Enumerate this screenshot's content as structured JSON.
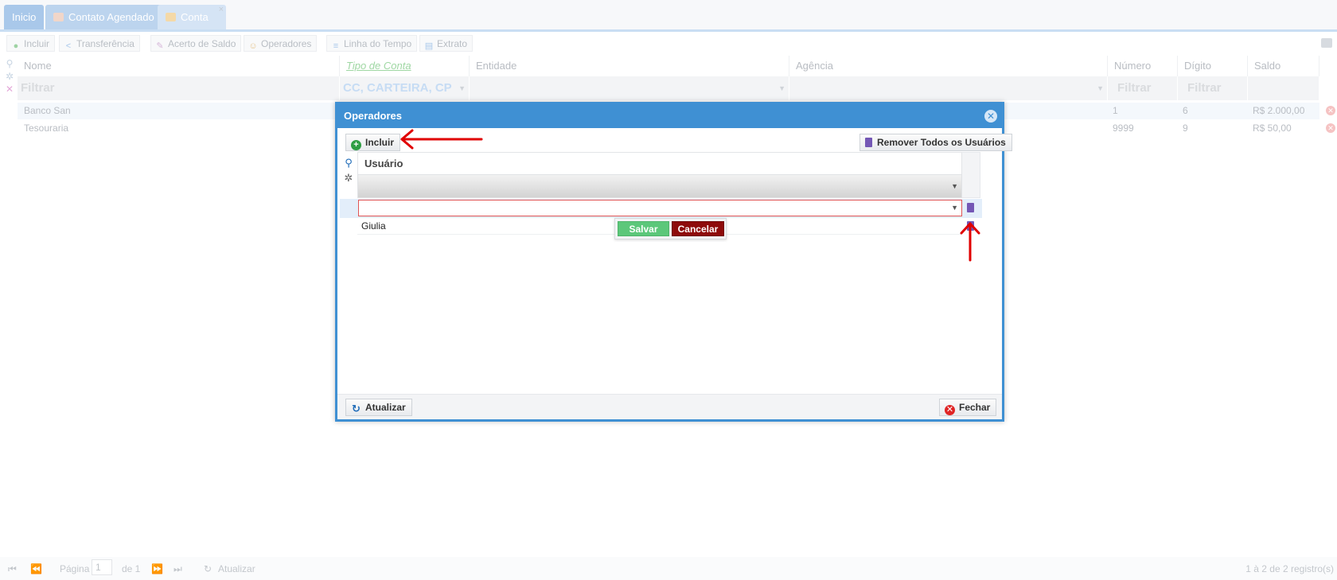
{
  "tabs": [
    {
      "label": "Inicio"
    },
    {
      "label": "Contato Agendado",
      "icon": "calendar-icon"
    },
    {
      "label": "Conta",
      "icon": "card-icon"
    }
  ],
  "toolbar": {
    "incluir": "Incluir",
    "transferencia": "Transferência",
    "acerto": "Acerto de Saldo",
    "operadores": "Operadores",
    "linha_tempo": "Linha do Tempo",
    "extrato": "Extrato"
  },
  "grid": {
    "columns": [
      "Nome",
      "Tipo de Conta",
      "Entidade",
      "Agência",
      "Número",
      "Dígito",
      "Saldo"
    ],
    "filters": {
      "nome": "Filtrar",
      "tipo": "CC, CARTEIRA, CP",
      "numero": "Filtrar",
      "digito": "Filtrar"
    },
    "rows": [
      {
        "nome": "Banco San",
        "numero": "1",
        "digito": "6",
        "saldo": "R$ 2.000,00"
      },
      {
        "nome": "Tesouraria",
        "numero": "9999",
        "digito": "9",
        "saldo": "R$ 50,00"
      }
    ]
  },
  "pager": {
    "page_label": "Página",
    "page_value": "1",
    "of_label": "de 1",
    "refresh": "Atualizar",
    "summary": "1 à 2 de 2 registro(s)"
  },
  "modal": {
    "title": "Operadores",
    "incluir": "Incluir",
    "remove_all": "Remover Todos os Usuários",
    "column_usuario": "Usuário",
    "rows": [
      {
        "usuario": "Giulia"
      }
    ],
    "save": "Salvar",
    "cancel": "Cancelar",
    "refresh": "Atualizar",
    "close": "Fechar"
  },
  "colors": {
    "modal_header": "#3f90d3",
    "tab_active": "#3f90d3",
    "save_button": "#5cc77a",
    "cancel_button": "#8e0b0b",
    "annotation_arrow": "#e00000"
  }
}
